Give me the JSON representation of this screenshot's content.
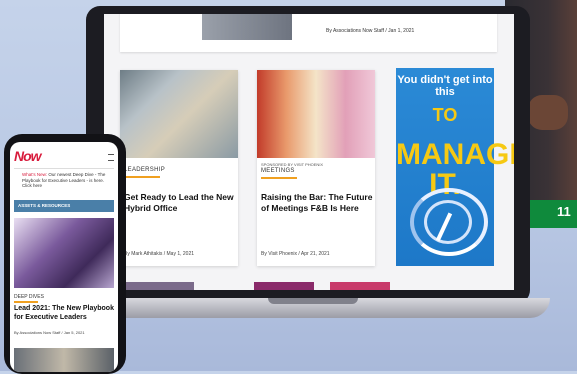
{
  "background": {
    "accent_green_number": "11"
  },
  "laptop": {
    "top_card": {
      "meta": "By Associations Now Staff / Jan 1, 2021"
    },
    "cards": [
      {
        "category": "LEADERSHIP",
        "title": "Get Ready to Lead the New Hybrid Office",
        "meta": "By Mark Athitakis / May 1, 2021",
        "sponsored": ""
      },
      {
        "category": "MEETINGS",
        "title": "Raising the Bar: The Future of Meetings F&B Is Here",
        "meta": "By Visit Phoenix / Apr 21, 2021",
        "sponsored": "SPONSORED BY VISIT PHOENIX"
      }
    ],
    "ad": {
      "line1": "You didn't get into this",
      "line2": "TO",
      "line3": "MANAGE IT."
    }
  },
  "phone": {
    "logo": "Now",
    "notice_red": "What's New:",
    "notice": "Our newest Deep Dive - The Playbook for Executive Leaders - is here. Click here",
    "banner": "ASSETS & RESOURCES",
    "category": "DEEP DIVES",
    "title": "Lead 2021: The New Playbook for Executive Leaders",
    "meta": "By Associations Now Staff / Jan 5, 2021"
  }
}
